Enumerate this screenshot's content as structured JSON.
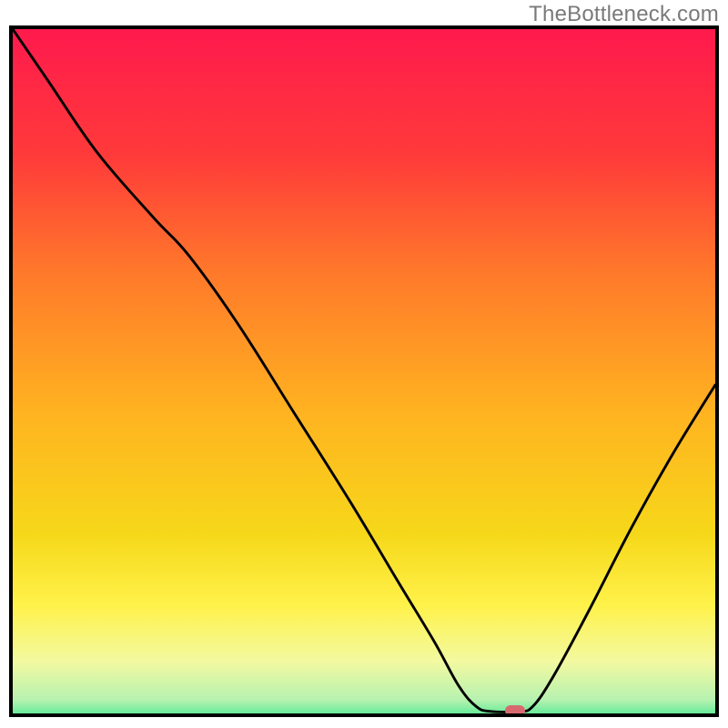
{
  "watermark": "TheBottleneck.com",
  "colors": {
    "frame": "#000000",
    "marker": "#d86a6f",
    "gradient_stops": [
      {
        "offset": 0.0,
        "color": "#ff1a4d"
      },
      {
        "offset": 0.18,
        "color": "#ff3a3a"
      },
      {
        "offset": 0.35,
        "color": "#ff7a2a"
      },
      {
        "offset": 0.55,
        "color": "#ffb420"
      },
      {
        "offset": 0.72,
        "color": "#f6d81a"
      },
      {
        "offset": 0.82,
        "color": "#fff24a"
      },
      {
        "offset": 0.9,
        "color": "#f3f9a0"
      },
      {
        "offset": 0.955,
        "color": "#b6f2b0"
      },
      {
        "offset": 0.99,
        "color": "#28e487"
      },
      {
        "offset": 1.0,
        "color": "#1ed978"
      }
    ]
  },
  "chart_data": {
    "type": "line",
    "title": "",
    "xlabel": "",
    "ylabel": "",
    "xlim": [
      0,
      100
    ],
    "ylim": [
      0,
      100
    ],
    "series": [
      {
        "name": "curve",
        "points": [
          {
            "x": 0.0,
            "y": 100.0
          },
          {
            "x": 5.0,
            "y": 92.5
          },
          {
            "x": 12.0,
            "y": 82.0
          },
          {
            "x": 20.0,
            "y": 72.5
          },
          {
            "x": 25.0,
            "y": 67.0
          },
          {
            "x": 32.0,
            "y": 57.0
          },
          {
            "x": 40.0,
            "y": 44.0
          },
          {
            "x": 48.0,
            "y": 31.0
          },
          {
            "x": 55.0,
            "y": 19.0
          },
          {
            "x": 60.0,
            "y": 10.5
          },
          {
            "x": 63.5,
            "y": 4.0
          },
          {
            "x": 66.0,
            "y": 1.0
          },
          {
            "x": 68.0,
            "y": 0.3
          },
          {
            "x": 72.0,
            "y": 0.3
          },
          {
            "x": 74.0,
            "y": 1.0
          },
          {
            "x": 77.0,
            "y": 5.5
          },
          {
            "x": 82.0,
            "y": 15.0
          },
          {
            "x": 88.0,
            "y": 27.0
          },
          {
            "x": 94.0,
            "y": 38.0
          },
          {
            "x": 100.0,
            "y": 48.0
          }
        ]
      }
    ],
    "marker": {
      "x": 71.5,
      "y": 0.4
    }
  }
}
